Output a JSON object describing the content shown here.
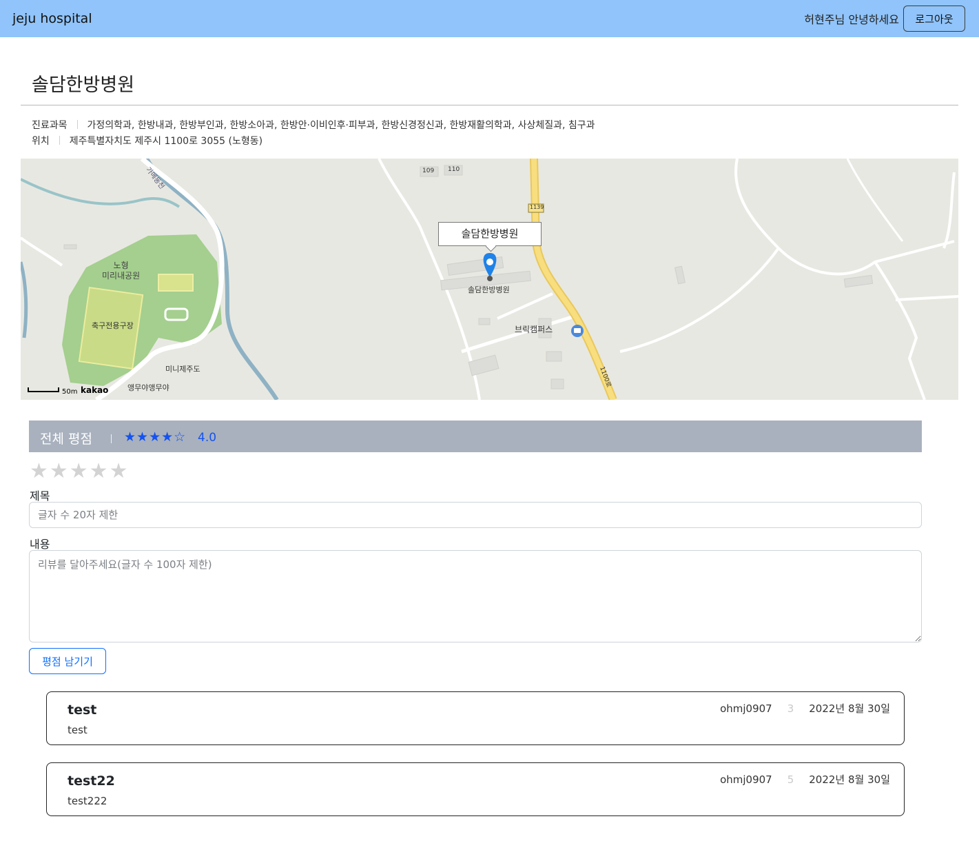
{
  "navbar": {
    "brand": "jeju hospital",
    "greeting": "허현주님 안녕하세요",
    "logout_label": "로그아웃",
    "bg_color": "#90c4fa"
  },
  "hospital": {
    "name": "솔담한방병원",
    "dept_label": "진료과목",
    "departments": "가정의학과, 한방내과, 한방부인과, 한방소아과, 한방안·이비인후·피부과, 한방신경정신과, 한방재활의학과, 사상체질과, 침구과",
    "location_label": "위치",
    "address": "제주특별자치도 제주시 1100로 3055 (노형동)"
  },
  "map": {
    "popup_label": "솔담한방병원",
    "marker_label": "솔담한방병원",
    "places": {
      "park": "노형\n미리내공원",
      "stadium": "축구전용구장",
      "minijeju": "미니제주도",
      "parrot": "앵무야앵무야",
      "campus": "브릭캠퍼스",
      "stream": "가메동천",
      "road": "1100로",
      "route_badge": "1139",
      "bldg_109": "109",
      "bldg_110": "110"
    },
    "scale": "50m",
    "provider": "kakao"
  },
  "rating": {
    "header_title": "전체 평점",
    "stars_display": "★★★★☆",
    "average": "4.0",
    "accent_color": "#1552ef",
    "input_stars": "★★★★★"
  },
  "form": {
    "title_label": "제목",
    "title_placeholder": "글자 수 20자 제한",
    "content_label": "내용",
    "content_placeholder": "리뷰를 달아주세요(글자 수 100자 제한)",
    "submit_label": "평점 남기기"
  },
  "reviews": [
    {
      "title": "test",
      "body": "test",
      "author": "ohmj0907",
      "score": "3",
      "date": "2022년 8월 30일"
    },
    {
      "title": "test22",
      "body": "test222",
      "author": "ohmj0907",
      "score": "5",
      "date": "2022년 8월 30일"
    }
  ]
}
